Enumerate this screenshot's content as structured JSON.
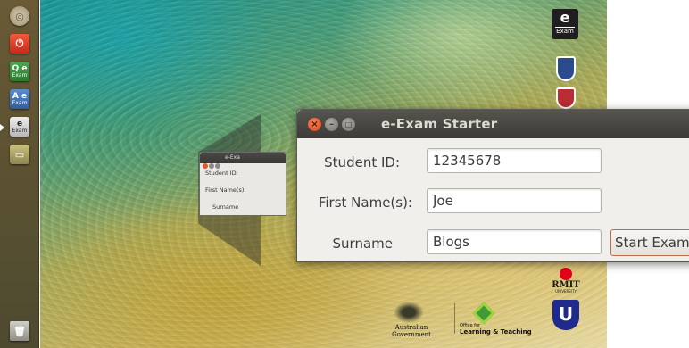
{
  "window": {
    "title": "e-Exam Starter",
    "close_glyph": "×",
    "minimize_glyph": "–",
    "maximize_glyph": "□"
  },
  "form": {
    "student_id_label": "Student ID:",
    "student_id_value": "12345678",
    "first_name_label": "First Name(s):",
    "first_name_value": "Joe",
    "surname_label": "Surname",
    "surname_value": "Blogs",
    "start_button_label": "Start Exam"
  },
  "ghost_window": {
    "title": "e-Exa",
    "student_id_label": "Student ID:",
    "first_name_label": "First Name(s):",
    "surname_label": "Surname"
  },
  "launcher": {
    "items": [
      "dash-home",
      "shutdown",
      "qe-exam",
      "ae-exam",
      "e-exam",
      "file-manager",
      "trash"
    ],
    "qe_label": "Q e",
    "ae_label": "A e",
    "e_label": "e",
    "exam_sub": "Exam"
  },
  "desktop_logos": {
    "e_exam_letter": "e",
    "e_exam_sub": "Exam",
    "rmit": "RMIT",
    "rmit_sub": "UNIVERSITY",
    "australian_government": "Australian Government",
    "olt_line1": "Office for",
    "olt_line2": "Learning & Teaching",
    "uni_shield_letter": "U"
  },
  "colors": {
    "titlebar": "#3c3b37",
    "close_button": "#e0562b",
    "start_button_border": "#c16a4a",
    "window_bg": "#f0efec"
  }
}
